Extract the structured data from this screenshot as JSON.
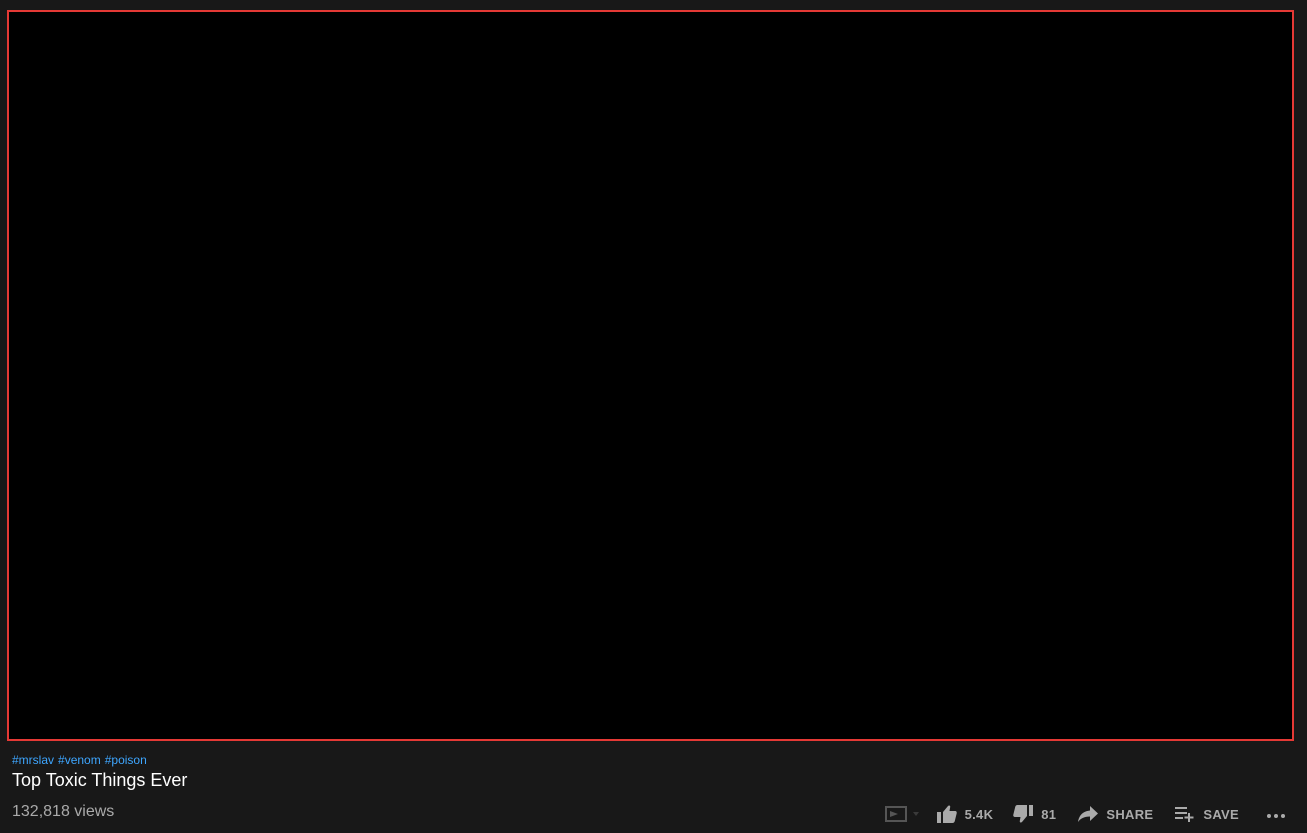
{
  "video": {
    "hashtags": [
      "#mrslav",
      "#venom",
      "#poison"
    ],
    "title": "Top Toxic Things Ever",
    "views": "132,818 views"
  },
  "actions": {
    "cast_icon": "cast-to-tv-icon",
    "like_icon": "thumbs-up-icon",
    "like_count": "5.4K",
    "dislike_icon": "thumbs-down-icon",
    "dislike_count": "81",
    "share_icon": "share-arrow-icon",
    "share_label": "SHARE",
    "save_icon": "playlist-add-icon",
    "save_label": "SAVE",
    "more_icon": "more-horizontal-icon"
  },
  "colors": {
    "background": "#181818",
    "player": "#000000",
    "player_border": "#e53935",
    "hashtag": "#3ea6ff",
    "title": "#ffffff",
    "secondary_text": "#aaaaaa"
  }
}
